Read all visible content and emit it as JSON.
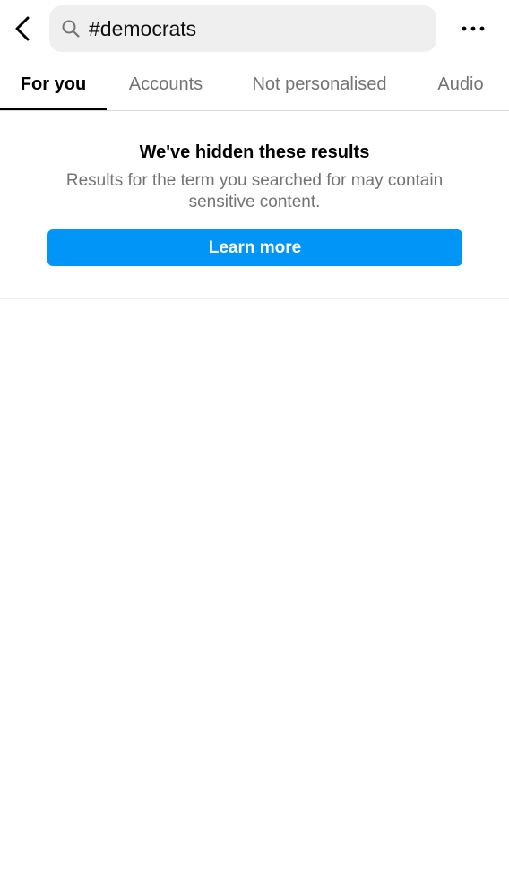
{
  "search": {
    "value": "#democrats",
    "icon": "search-icon"
  },
  "topbar": {
    "back_icon": "chevron-left-icon",
    "more_icon": "more-horizontal-icon"
  },
  "tabs": [
    {
      "label": "For you",
      "active": true
    },
    {
      "label": "Accounts",
      "active": false
    },
    {
      "label": "Not personalised",
      "active": false
    },
    {
      "label": "Audio",
      "active": false
    }
  ],
  "notice": {
    "title": "We've hidden these results",
    "body": "Results for the term you searched for may contain sensitive content.",
    "button_label": "Learn more"
  },
  "colors": {
    "accent": "#0095f6",
    "secondary_text": "#737373",
    "search_bg": "#efefef"
  }
}
